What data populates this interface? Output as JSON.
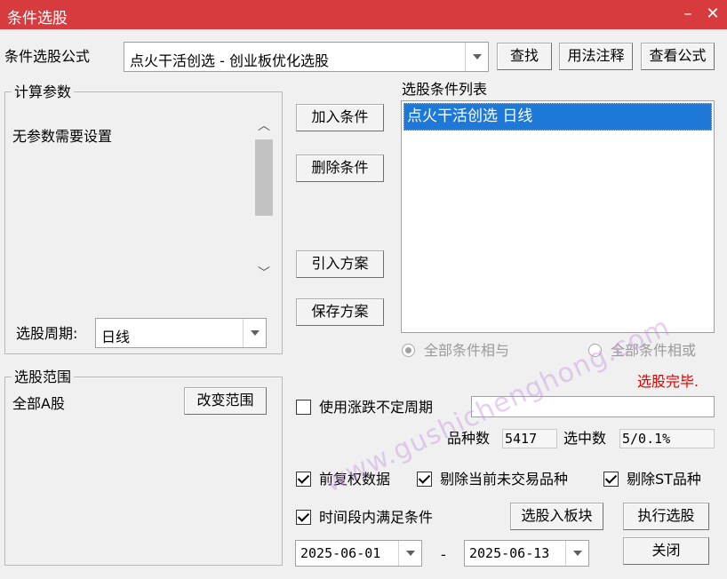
{
  "window": {
    "title": "条件选股",
    "minimize": "–",
    "close": "✕"
  },
  "formula": {
    "label": "条件选股公式",
    "value": "点火干活创选  -  创业板优化选股",
    "find_button": "查找",
    "usage_button": "用法注释",
    "view_button": "查看公式"
  },
  "params": {
    "title": "计算参数",
    "message": "无参数需要设置",
    "period_label": "选股周期:",
    "period_value": "日线"
  },
  "actions": {
    "add": "加入条件",
    "remove": "删除条件",
    "import": "引入方案",
    "save": "保存方案"
  },
  "conditions": {
    "title": "选股条件列表",
    "items": [
      "点火干活创选  日线"
    ],
    "and_label": "全部条件相与",
    "or_label": "全部条件相或"
  },
  "status": {
    "done": "选股完毕."
  },
  "range": {
    "title": "选股范围",
    "value": "全部A股",
    "change_button": "改变范围"
  },
  "options": {
    "variable_period_label": "使用涨跌不定周期",
    "variable_period_value": "",
    "adjust_label": "前复权数据",
    "exclude_untraded_label": "剔除当前未交易品种",
    "exclude_st_label": "剔除ST品种",
    "time_range_label": "时间段内满足条件"
  },
  "stats": {
    "count_label": "品种数",
    "count_value": "5417",
    "selected_label": "选中数",
    "selected_value": "5/0.1%"
  },
  "dates": {
    "start": "2025-06-01",
    "separator": "-",
    "end": "2025-06-13"
  },
  "buttons": {
    "to_block": "选股入板块",
    "execute": "执行选股",
    "close": "关闭"
  },
  "watermark": "www.gushichenghong.com"
}
